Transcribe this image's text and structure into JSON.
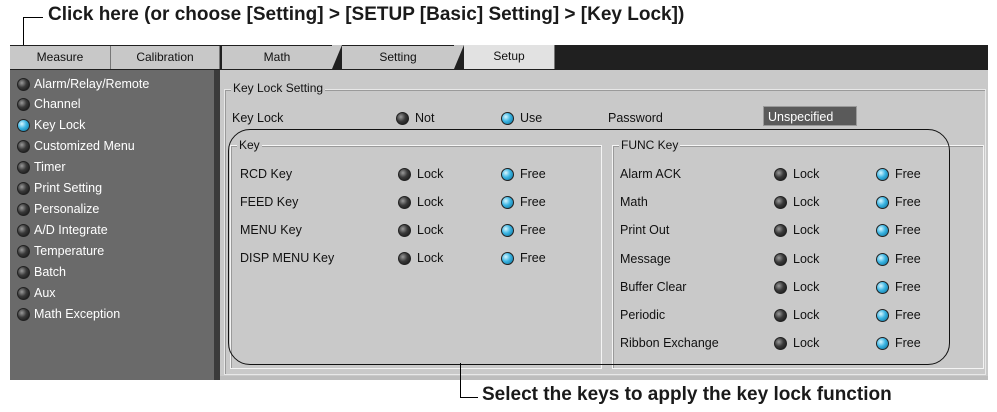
{
  "annotations": {
    "top_callout": "Click here (or choose [Setting] > [SETUP [Basic] Setting] > [Key Lock])",
    "bottom_callout": "Select the keys to apply the key lock function"
  },
  "tabs": [
    {
      "label": "Measure"
    },
    {
      "label": "Calibration"
    },
    {
      "label": "Math"
    },
    {
      "label": "Setting"
    },
    {
      "label": "Setup"
    }
  ],
  "sidebar": {
    "items": [
      {
        "label": "Alarm/Relay/Remote"
      },
      {
        "label": "Channel"
      },
      {
        "label": "Key Lock"
      },
      {
        "label": "Customized Menu"
      },
      {
        "label": "Timer"
      },
      {
        "label": "Print Setting"
      },
      {
        "label": "Personalize"
      },
      {
        "label": "A/D Integrate"
      },
      {
        "label": "Temperature"
      },
      {
        "label": "Batch"
      },
      {
        "label": "Aux"
      },
      {
        "label": "Math Exception"
      }
    ],
    "selected": "Key Lock"
  },
  "key_lock_setting": {
    "title": "Key Lock Setting",
    "key_lock_label": "Key Lock",
    "opt_not": "Not",
    "opt_use": "Use",
    "selected": "Use",
    "password_label": "Password",
    "password_value": "Unspecified"
  },
  "key_group": {
    "title": "Key",
    "lock_label": "Lock",
    "free_label": "Free",
    "rows": [
      {
        "label": "RCD Key",
        "selected": "Free"
      },
      {
        "label": "FEED Key",
        "selected": "Free"
      },
      {
        "label": "MENU Key",
        "selected": "Free"
      },
      {
        "label": "DISP MENU Key",
        "selected": "Free"
      }
    ]
  },
  "func_group": {
    "title": "FUNC Key",
    "lock_label": "Lock",
    "free_label": "Free",
    "rows": [
      {
        "label": "Alarm ACK",
        "selected": "Free"
      },
      {
        "label": "Math",
        "selected": "Free"
      },
      {
        "label": "Print Out",
        "selected": "Free"
      },
      {
        "label": "Message",
        "selected": "Free"
      },
      {
        "label": "Buffer Clear",
        "selected": "Free"
      },
      {
        "label": "Periodic",
        "selected": "Free"
      },
      {
        "label": "Ribbon Exchange",
        "selected": "Free"
      }
    ]
  },
  "colors": {
    "led_on": "#3ab4e2",
    "led_off": "#3a3a3a",
    "sidebar_bg": "#6a6a6a",
    "panel_bg": "#c9c9c9"
  }
}
